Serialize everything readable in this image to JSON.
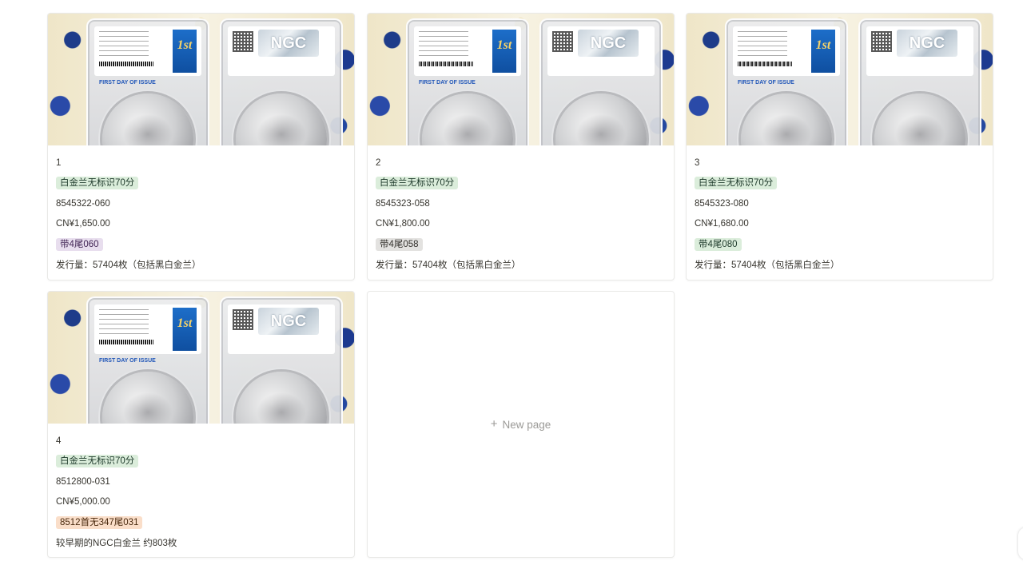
{
  "new_page": {
    "label": "New page",
    "icon": "plus-icon"
  },
  "tag_colors": {
    "green": {
      "bg": "#dbeddb",
      "fg": "#1c3829"
    },
    "purple": {
      "bg": "#e8deee",
      "fg": "#412454"
    },
    "gray": {
      "bg": "#e3e2e0",
      "fg": "#32302c"
    },
    "orange": {
      "bg": "#fadec9",
      "fg": "#49290e"
    }
  },
  "cards": [
    {
      "name": "1",
      "type_tag": "白金兰无标识70分",
      "type_color": "green",
      "cert_no": "8545322-060",
      "price": "CN¥1,650.00",
      "note_tag": "带4尾060",
      "note_color": "purple",
      "remark": "发行量：57404枚（包括黑白金兰）"
    },
    {
      "name": "2",
      "type_tag": "白金兰无标识70分",
      "type_color": "green",
      "cert_no": "8545323-058",
      "price": "CN¥1,800.00",
      "note_tag": "带4尾058",
      "note_color": "gray",
      "remark": "发行量：57404枚（包括黑白金兰）"
    },
    {
      "name": "3",
      "type_tag": "白金兰无标识70分",
      "type_color": "green",
      "cert_no": "8545323-080",
      "price": "CN¥1,680.00",
      "note_tag": "带4尾080",
      "note_color": "green",
      "remark": "发行量：57404枚（包括黑白金兰）"
    },
    {
      "name": "4",
      "type_tag": "白金兰无标识70分",
      "type_color": "green",
      "cert_no": "8512800-031",
      "price": "CN¥5,000.00",
      "note_tag": "8512首无347尾031",
      "note_color": "orange",
      "remark": "较早期的NGC白金兰 约803枚"
    }
  ],
  "cover": {
    "label_text": "FIRST DAY OF ISSUE",
    "badge_text": "1st",
    "grader_logo": "NGC"
  }
}
